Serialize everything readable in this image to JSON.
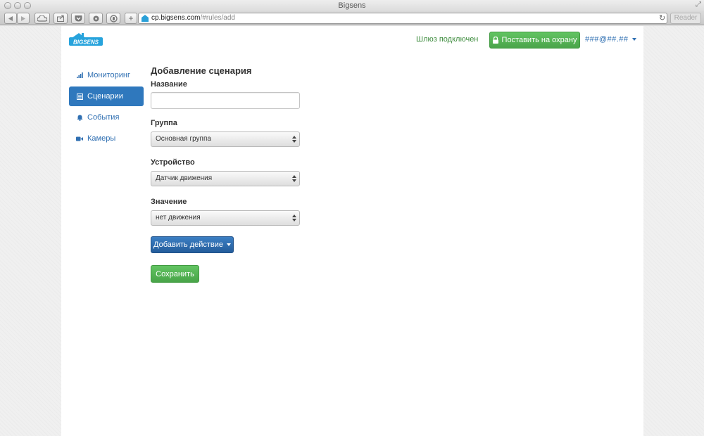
{
  "window": {
    "title": "Bigsens"
  },
  "browser": {
    "url_domain": "cp.bigsens.com",
    "url_path": "/#rules/add",
    "reader_label": "Reader"
  },
  "header": {
    "logo_text": "BIGSENS",
    "gateway_status": "Шлюз подключен",
    "arm_button": "Поставить на охрану",
    "user_email": "###@##.##"
  },
  "sidebar": {
    "items": [
      {
        "label": "Мониторинг",
        "icon": "signal-bars-icon"
      },
      {
        "label": "Сценарии",
        "icon": "list-icon",
        "active": true
      },
      {
        "label": "События",
        "icon": "bell-icon"
      },
      {
        "label": "Камеры",
        "icon": "video-camera-icon"
      }
    ]
  },
  "form": {
    "title": "Добавление сценария",
    "name_label": "Название",
    "name_value": "",
    "group_label": "Группа",
    "group_value": "Основная группа",
    "device_label": "Устройство",
    "device_value": "Датчик движения",
    "value_label": "Значение",
    "value_value": "нет движения",
    "add_action_button": "Добавить действие",
    "save_button": "Сохранить"
  },
  "colors": {
    "primary_blue": "#2f78bd",
    "success_green": "#5cb85c",
    "link_blue": "#2f6fb2"
  }
}
